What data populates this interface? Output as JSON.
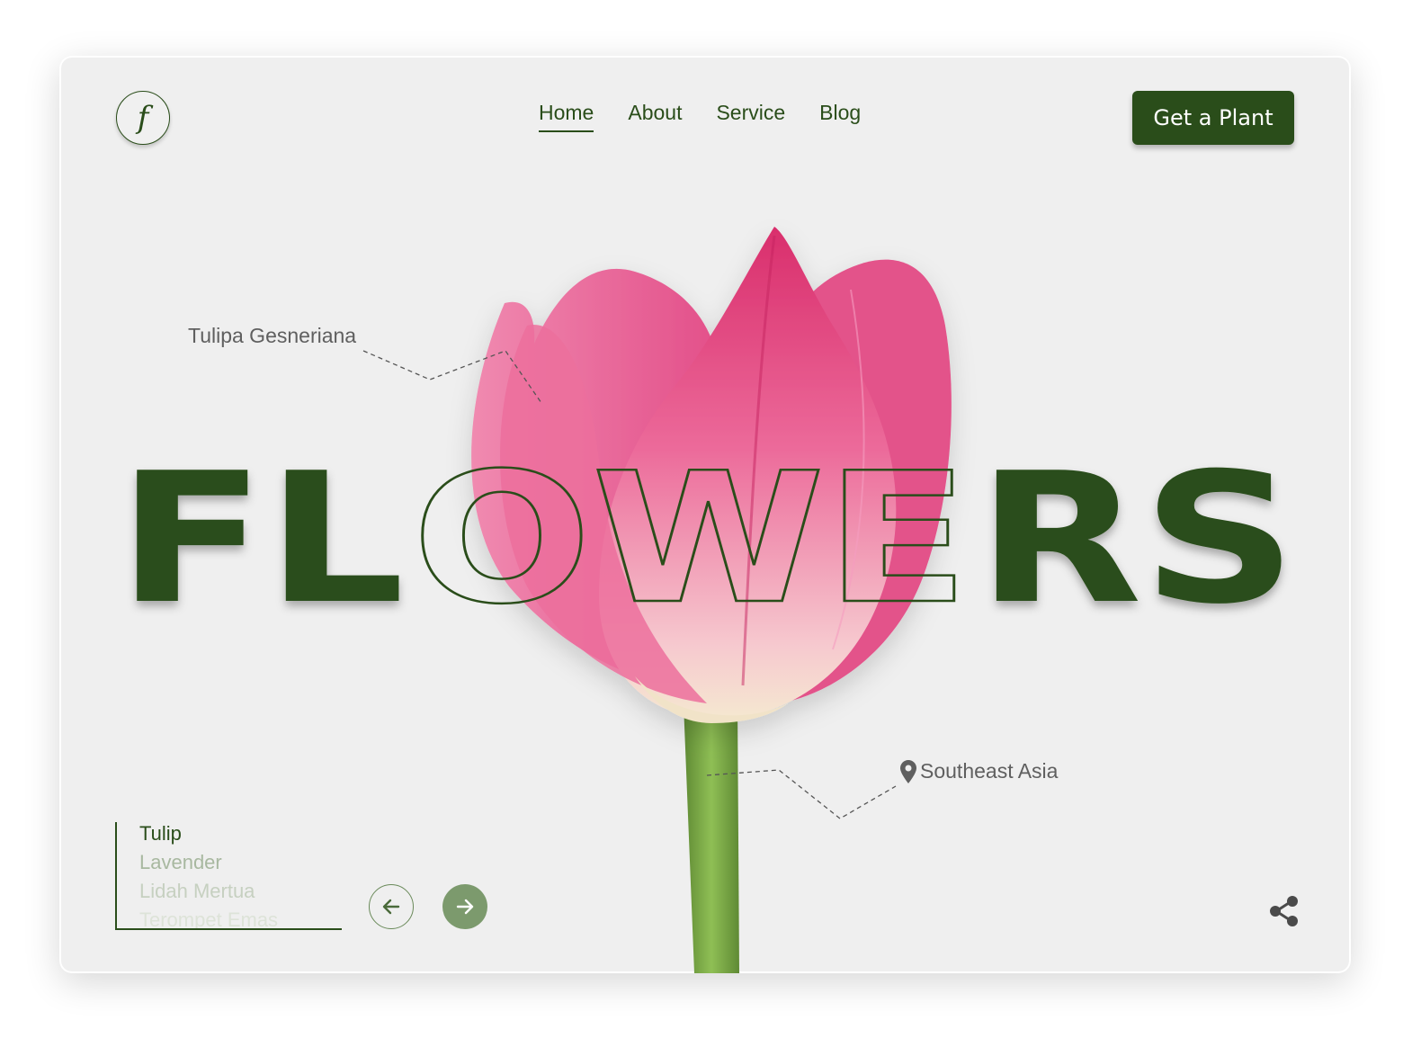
{
  "logo": {
    "letter": "f"
  },
  "nav": {
    "items": [
      {
        "label": "Home",
        "active": true
      },
      {
        "label": "About",
        "active": false
      },
      {
        "label": "Service",
        "active": false
      },
      {
        "label": "Blog",
        "active": false
      }
    ]
  },
  "cta": {
    "label": "Get a Plant"
  },
  "hero": {
    "word_solid_left": "FL",
    "word_outline": "OWE",
    "word_solid_right": "RS"
  },
  "annotations": {
    "species": "Tulipa Gesneriana",
    "region": "Southeast Asia"
  },
  "plant_list": {
    "items": [
      "Tulip",
      "Lavender",
      "Lidah Mertua",
      "Terompet Emas"
    ]
  },
  "icons": {
    "prev": "arrow-left-icon",
    "next": "arrow-right-icon",
    "location": "map-pin-icon",
    "share": "share-icon"
  },
  "colors": {
    "brand_green": "#2a4d1a",
    "background": "#efefef",
    "tulip_pink": "#e8447a",
    "stem_green": "#7aa84a"
  }
}
